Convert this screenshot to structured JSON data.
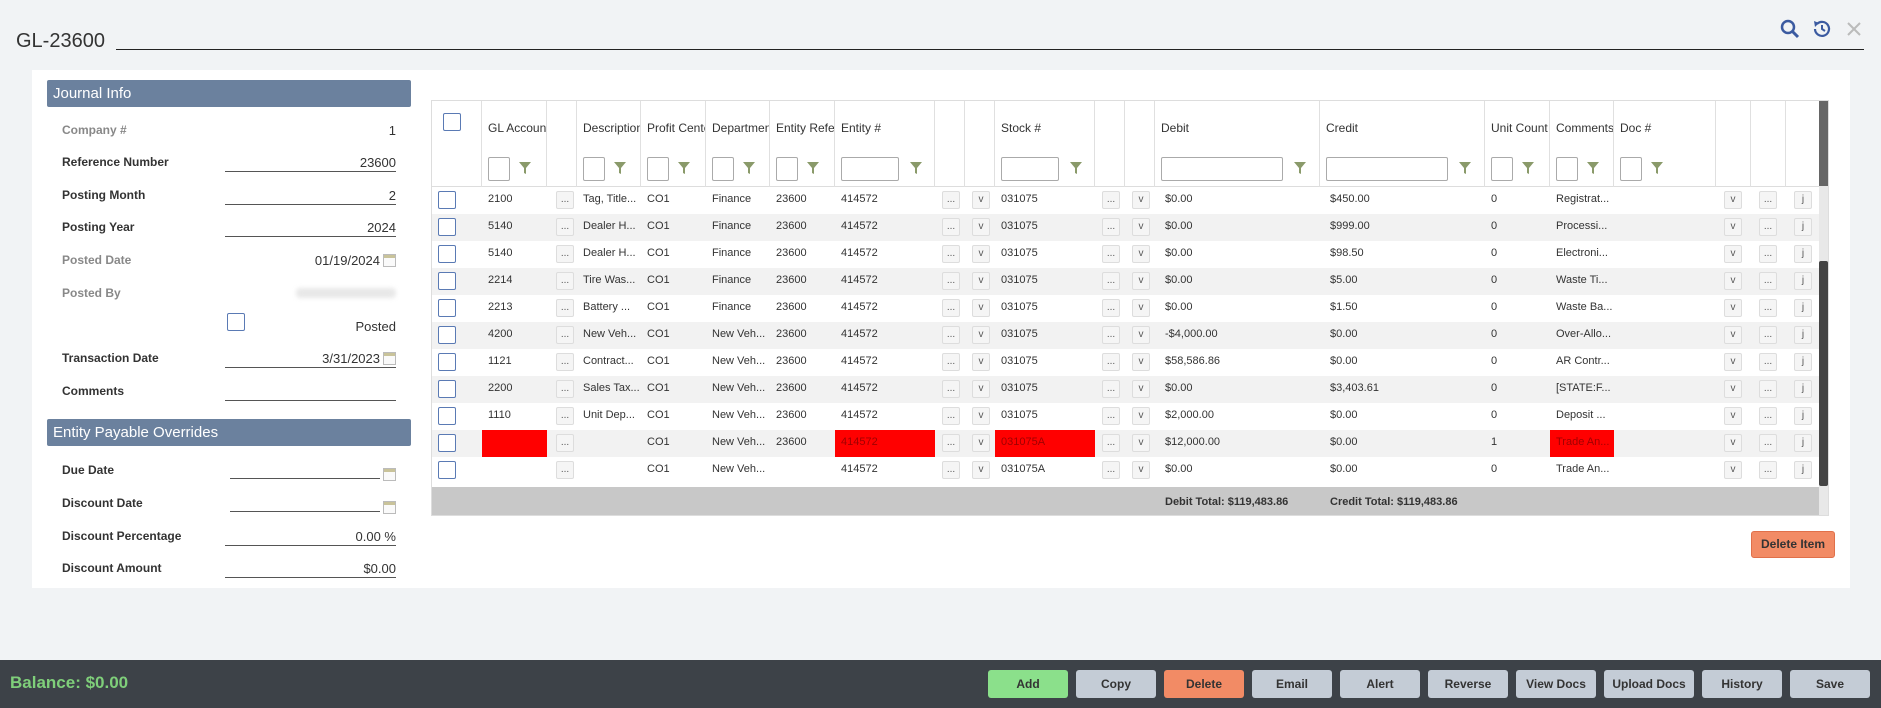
{
  "window": {
    "title": "GL-23600"
  },
  "journal_info": {
    "header": "Journal Info",
    "company_label": "Company #",
    "company_value": "1",
    "reference_label": "Reference Number",
    "reference_value": "23600",
    "posting_month_label": "Posting Month",
    "posting_month_value": "2",
    "posting_year_label": "Posting Year",
    "posting_year_value": "2024",
    "posted_date_label": "Posted Date",
    "posted_date_value": "01/19/2024",
    "posted_by_label": "Posted By",
    "posted_checkbox_label": "Posted",
    "transaction_date_label": "Transaction Date",
    "transaction_date_value": "3/31/2023",
    "comments_label": "Comments",
    "comments_value": ""
  },
  "overrides": {
    "header": "Entity Payable Overrides",
    "due_date_label": "Due Date",
    "due_date_value": "",
    "discount_date_label": "Discount Date",
    "discount_date_value": "",
    "discount_pct_label": "Discount Percentage",
    "discount_pct_value": "0.00 %",
    "discount_amount_label": "Discount Amount",
    "discount_amount_value": "$0.00"
  },
  "grid": {
    "columns": {
      "gl_account": "GL Account",
      "description": "Description",
      "profit_center": "Profit Center",
      "department": "Department",
      "entity_reference": "Entity Reference",
      "entity": "Entity #",
      "stock": "Stock #",
      "debit": "Debit",
      "credit": "Credit",
      "unit_count": "Unit Count",
      "comments": "Comments",
      "doc": "Doc #"
    },
    "buttons": {
      "ellipsis": "...",
      "v": "v",
      "j": "j",
      "s": "s"
    },
    "rows": [
      {
        "gl": "2100",
        "desc": "Tag, Title...",
        "pc": "CO1",
        "dept": "Finance",
        "ref": "23600",
        "entity": "414572",
        "stock": "031075",
        "debit": "$0.00",
        "credit": "$450.00",
        "units": "0",
        "comments": "Registrat..."
      },
      {
        "gl": "5140",
        "desc": "Dealer H...",
        "pc": "CO1",
        "dept": "Finance",
        "ref": "23600",
        "entity": "414572",
        "stock": "031075",
        "debit": "$0.00",
        "credit": "$999.00",
        "units": "0",
        "comments": "Processi..."
      },
      {
        "gl": "5140",
        "desc": "Dealer H...",
        "pc": "CO1",
        "dept": "Finance",
        "ref": "23600",
        "entity": "414572",
        "stock": "031075",
        "debit": "$0.00",
        "credit": "$98.50",
        "units": "0",
        "comments": "Electroni..."
      },
      {
        "gl": "2214",
        "desc": "Tire Was...",
        "pc": "CO1",
        "dept": "Finance",
        "ref": "23600",
        "entity": "414572",
        "stock": "031075",
        "debit": "$0.00",
        "credit": "$5.00",
        "units": "0",
        "comments": "Waste Ti..."
      },
      {
        "gl": "2213",
        "desc": "Battery ...",
        "pc": "CO1",
        "dept": "Finance",
        "ref": "23600",
        "entity": "414572",
        "stock": "031075",
        "debit": "$0.00",
        "credit": "$1.50",
        "units": "0",
        "comments": "Waste Ba..."
      },
      {
        "gl": "4200",
        "desc": "New Veh...",
        "pc": "CO1",
        "dept": "New Veh...",
        "ref": "23600",
        "entity": "414572",
        "stock": "031075",
        "debit": "-$4,000.00",
        "credit": "$0.00",
        "units": "0",
        "comments": "Over-Allo..."
      },
      {
        "gl": "1121",
        "desc": "Contract...",
        "pc": "CO1",
        "dept": "New Veh...",
        "ref": "23600",
        "entity": "414572",
        "stock": "031075",
        "debit": "$58,586.86",
        "credit": "$0.00",
        "units": "0",
        "comments": "AR Contr..."
      },
      {
        "gl": "2200",
        "desc": "Sales Tax...",
        "pc": "CO1",
        "dept": "New Veh...",
        "ref": "23600",
        "entity": "414572",
        "stock": "031075",
        "debit": "$0.00",
        "credit": "$3,403.61",
        "units": "0",
        "comments": "[STATE:F..."
      },
      {
        "gl": "1110",
        "desc": "Unit Dep...",
        "pc": "CO1",
        "dept": "New Veh...",
        "ref": "23600",
        "entity": "414572",
        "stock": "031075",
        "debit": "$2,000.00",
        "credit": "$0.00",
        "units": "0",
        "comments": "Deposit ..."
      },
      {
        "gl": "",
        "desc": "",
        "pc": "CO1",
        "dept": "New Veh...",
        "ref": "23600",
        "entity": "414572",
        "stock": "031075A",
        "debit": "$12,000.00",
        "credit": "$0.00",
        "units": "1",
        "comments": "Trade An...",
        "highlight": true
      },
      {
        "gl": "",
        "desc": "",
        "pc": "CO1",
        "dept": "New Veh...",
        "ref": "",
        "entity": "414572",
        "stock": "031075A",
        "debit": "$0.00",
        "credit": "$0.00",
        "units": "0",
        "comments": "Trade An..."
      }
    ],
    "debit_total": "Debit Total: $119,483.86",
    "credit_total": "Credit Total: $119,483.86"
  },
  "delete_item_label": "Delete Item",
  "footer": {
    "balance": "Balance: $0.00",
    "buttons": [
      "Add",
      "Copy",
      "Delete",
      "Email",
      "Alert",
      "Reverse",
      "View Docs",
      "Upload Docs",
      "History",
      "Save"
    ]
  },
  "colors": {
    "section_header": "#6b819e",
    "add_button": "#8be08b",
    "delete_button": "#f28b65",
    "error_cell": "#ff0000",
    "balance_text": "#7fcf7a"
  }
}
